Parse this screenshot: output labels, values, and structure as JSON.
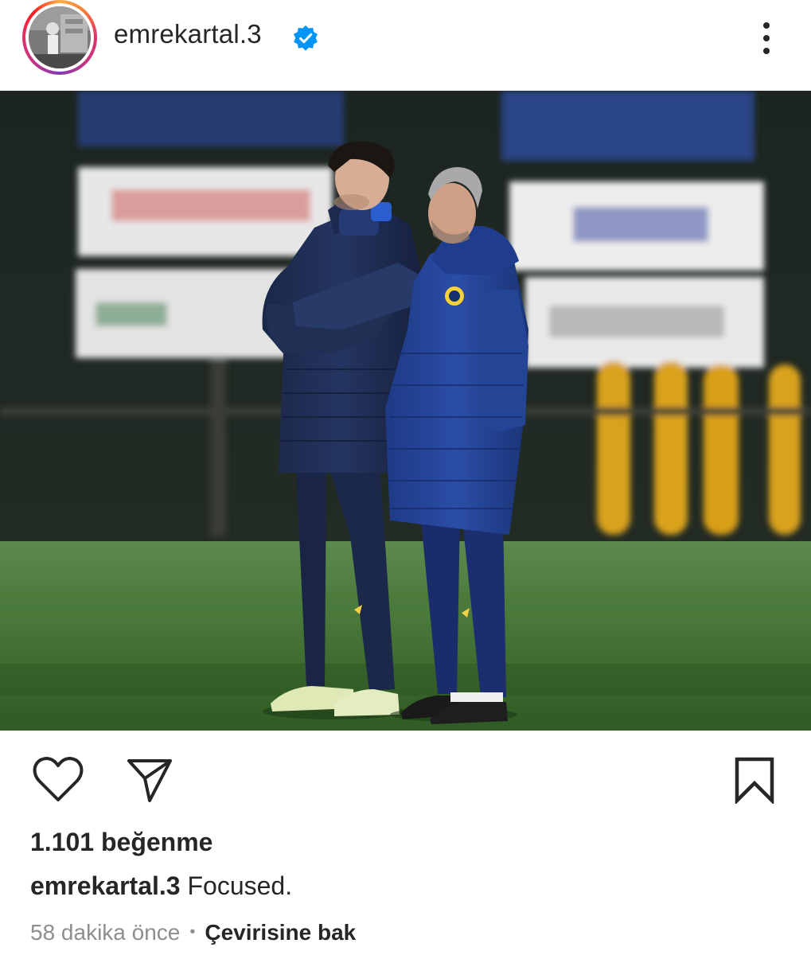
{
  "post": {
    "username": "emrekartal.3",
    "verified": true,
    "likes_text": "1.101 beğenme",
    "caption_user": "emrekartal.3",
    "caption_text": "Focused.",
    "time_ago": "58 dakika önce",
    "separator": "•",
    "translate_label": "Çevirisine bak"
  },
  "icons": {
    "verified": "verified-badge-icon",
    "more": "more-options-icon",
    "like": "heart-icon",
    "share": "send-icon",
    "save": "bookmark-icon"
  },
  "colors": {
    "text": "#262626",
    "secondary_text": "#8e8e8e",
    "verified_blue": "#0095f6",
    "background": "#ffffff"
  }
}
